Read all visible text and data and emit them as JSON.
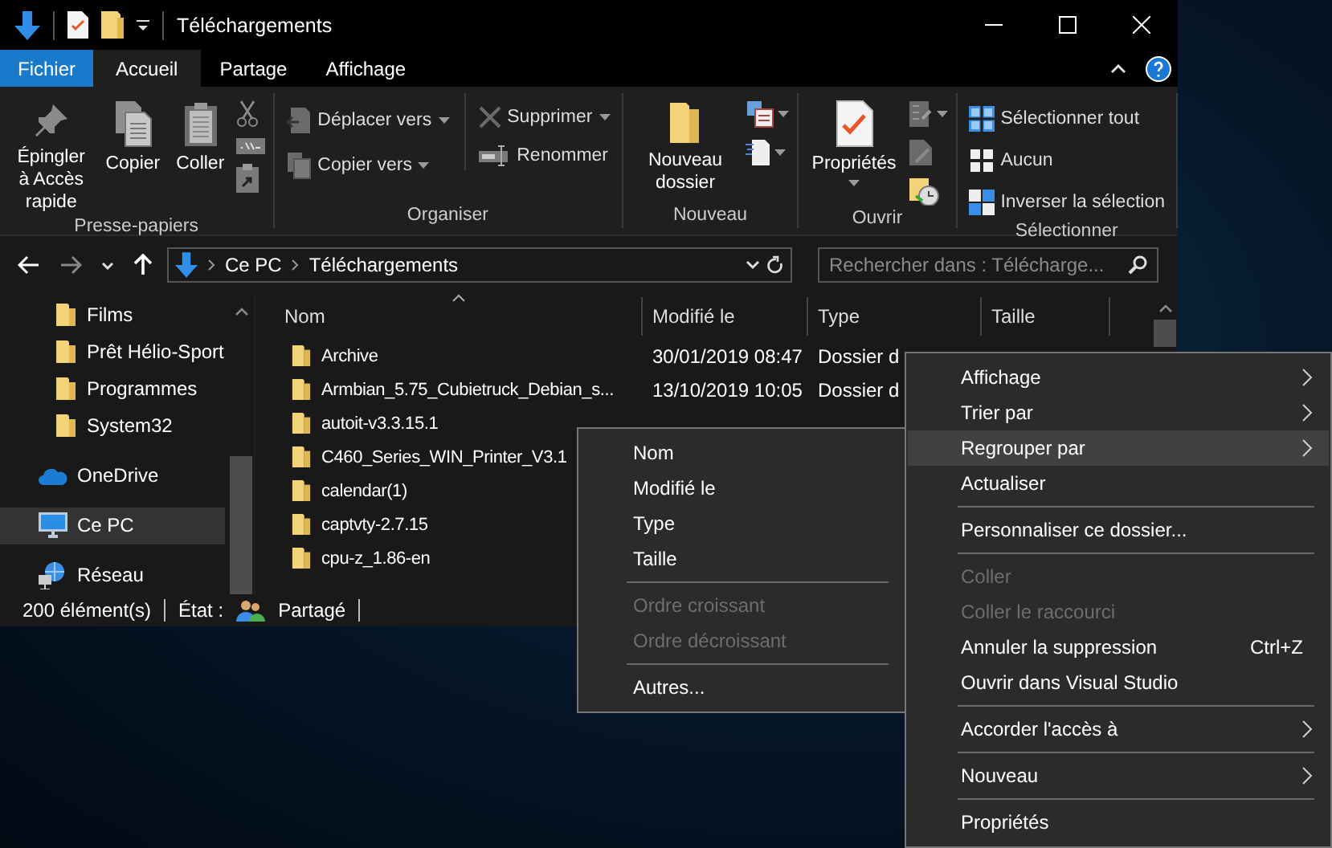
{
  "window": {
    "title": "Téléchargements"
  },
  "ribbon_tabs": [
    {
      "label": "Fichier",
      "kind": "file",
      "selected": false
    },
    {
      "label": "Accueil",
      "kind": "tab",
      "selected": true
    },
    {
      "label": "Partage",
      "kind": "tab",
      "selected": false
    },
    {
      "label": "Affichage",
      "kind": "tab",
      "selected": false
    }
  ],
  "ribbon_groups": [
    {
      "label": "Presse-papiers",
      "items": [
        {
          "kind": "large",
          "label": "Épingler à Accès rapide"
        },
        {
          "kind": "large",
          "label": "Copier"
        },
        {
          "kind": "large",
          "label": "Coller"
        },
        {
          "kind": "icon_column"
        }
      ]
    },
    {
      "label": "Organiser",
      "items": [
        {
          "kind": "small_column",
          "entries": [
            {
              "label": "Déplacer vers",
              "dropdown": true
            },
            {
              "label": "Copier vers",
              "dropdown": true
            }
          ]
        },
        {
          "kind": "small_column",
          "entries": [
            {
              "label": "Supprimer",
              "dropdown": true
            },
            {
              "label": "Renommer",
              "dropdown": false
            }
          ]
        }
      ]
    },
    {
      "label": "Nouveau",
      "items": [
        {
          "kind": "large",
          "label": "Nouveau dossier"
        },
        {
          "kind": "icon_column"
        }
      ]
    },
    {
      "label": "Ouvrir",
      "items": [
        {
          "kind": "large",
          "label": "Propriétés",
          "dropdown": true
        },
        {
          "kind": "icon_column"
        }
      ]
    },
    {
      "label": "Sélectionner",
      "items": [
        {
          "kind": "small_column",
          "entries": [
            {
              "label": "Sélectionner tout"
            },
            {
              "label": "Aucun"
            },
            {
              "label": "Inverser la sélection"
            }
          ]
        }
      ]
    }
  ],
  "address_bar": {
    "path": [
      {
        "label": "Ce PC"
      },
      {
        "label": "Téléchargements"
      }
    ]
  },
  "search": {
    "placeholder": "Rechercher dans : Télécharge..."
  },
  "navigation": [
    {
      "label": "Films",
      "kind": "folder",
      "selected": false
    },
    {
      "label": "Prêt Hélio-Sport",
      "kind": "folder",
      "selected": false
    },
    {
      "label": "Programmes",
      "kind": "folder",
      "selected": false
    },
    {
      "label": "System32",
      "kind": "folder",
      "selected": false
    },
    {
      "label": "OneDrive",
      "kind": "cloud",
      "selected": false
    },
    {
      "label": "Ce PC",
      "kind": "pc",
      "selected": true
    },
    {
      "label": "Réseau",
      "kind": "network",
      "selected": false
    }
  ],
  "table": {
    "columns": [
      {
        "label": "Nom",
        "sorted": true
      },
      {
        "label": "Modifié le",
        "sorted": false
      },
      {
        "label": "Type",
        "sorted": false
      },
      {
        "label": "Taille",
        "sorted": false
      }
    ],
    "rows": [
      {
        "name": "Archive",
        "modified": "30/01/2019 08:47",
        "type": "Dossier d"
      },
      {
        "name": "Armbian_5.75_Cubietruck_Debian_s...",
        "modified": "13/10/2019 10:05",
        "type": "Dossier d"
      },
      {
        "name": "autoit-v3.3.15.1"
      },
      {
        "name": "C460_Series_WIN_Printer_V3.1"
      },
      {
        "name": "calendar(1)"
      },
      {
        "name": "captvty-2.7.15"
      },
      {
        "name": "cpu-z_1.86-en"
      }
    ]
  },
  "status_bar": {
    "count": "200 élément(s)",
    "state_label": "État :",
    "state_value": "Partagé"
  },
  "context_menu": {
    "items": [
      {
        "kind": "item",
        "label": "Affichage",
        "submenu": true,
        "disabled": false,
        "highlighted": false
      },
      {
        "kind": "item",
        "label": "Trier par",
        "submenu": true,
        "disabled": false,
        "highlighted": false
      },
      {
        "kind": "item",
        "label": "Regrouper par",
        "submenu": true,
        "disabled": false,
        "highlighted": true
      },
      {
        "kind": "item",
        "label": "Actualiser",
        "submenu": false,
        "disabled": false,
        "highlighted": false
      },
      {
        "kind": "separator"
      },
      {
        "kind": "item",
        "label": "Personnaliser ce dossier...",
        "submenu": false,
        "disabled": false,
        "highlighted": false
      },
      {
        "kind": "separator"
      },
      {
        "kind": "item",
        "label": "Coller",
        "submenu": false,
        "disabled": true,
        "highlighted": false
      },
      {
        "kind": "item",
        "label": "Coller le raccourci",
        "submenu": false,
        "disabled": true,
        "highlighted": false
      },
      {
        "kind": "item",
        "label": "Annuler la suppression",
        "shortcut": "Ctrl+Z",
        "submenu": false,
        "disabled": false,
        "highlighted": false
      },
      {
        "kind": "item",
        "label": "Ouvrir dans Visual Studio",
        "submenu": false,
        "disabled": false,
        "highlighted": false
      },
      {
        "kind": "separator"
      },
      {
        "kind": "item",
        "label": "Accorder l'accès à",
        "submenu": true,
        "disabled": false,
        "highlighted": false
      },
      {
        "kind": "separator"
      },
      {
        "kind": "item",
        "label": "Nouveau",
        "submenu": true,
        "disabled": false,
        "highlighted": false
      },
      {
        "kind": "separator"
      },
      {
        "kind": "item",
        "label": "Propriétés",
        "submenu": false,
        "disabled": false,
        "highlighted": false
      }
    ]
  },
  "group_by_menu": {
    "items": [
      {
        "kind": "item",
        "label": "Nom",
        "disabled": false
      },
      {
        "kind": "item",
        "label": "Modifié le",
        "disabled": false
      },
      {
        "kind": "item",
        "label": "Type",
        "disabled": false
      },
      {
        "kind": "item",
        "label": "Taille",
        "disabled": false
      },
      {
        "kind": "separator"
      },
      {
        "kind": "item",
        "label": "Ordre croissant",
        "disabled": true
      },
      {
        "kind": "item",
        "label": "Ordre décroissant",
        "disabled": true
      },
      {
        "kind": "separator"
      },
      {
        "kind": "item",
        "label": "Autres...",
        "disabled": false
      }
    ]
  }
}
